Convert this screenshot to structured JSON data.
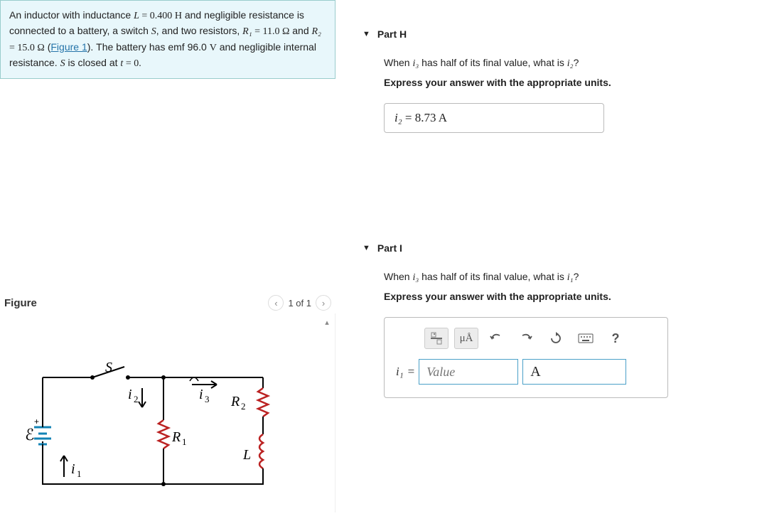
{
  "problem": {
    "text_pre_L": "An inductor with inductance ",
    "L_sym": "L",
    "L_eq": " = 0.400 ",
    "L_unit": "H",
    "text_after_L": " and negligible resistance is connected to a battery, a switch ",
    "S_sym": "S",
    "text_after_S": ", and two resistors, ",
    "R1_sym": "R₁",
    "R1_eq": " = 11.0 ",
    "ohm": "Ω",
    "and": " and ",
    "R2_sym": "R₂",
    "R2_eq": " = 15.0 ",
    "fig_open": " (",
    "figure_link": "Figure 1",
    "fig_close": "). The battery has emf 96.0 ",
    "V": "V",
    "text_after_emf": " and negligible internal resistance. ",
    "S_sym2": "S",
    "text_close": " is closed at ",
    "t_sym": "t",
    "t_eq": " = 0."
  },
  "figure": {
    "title": "Figure",
    "pager": "1 of 1",
    "labels": {
      "S": "S",
      "i1": "i₁",
      "i2": "i₂",
      "i3": "i₃",
      "R1": "R₁",
      "R2": "R₂",
      "L": "L",
      "emf": "ℰ"
    }
  },
  "partH": {
    "title": "Part H",
    "question_pre": "When ",
    "i3": "i₃",
    "question_mid": " has half of its final value, what is ",
    "i2": "i₂",
    "question_post": "?",
    "instruction": "Express your answer with the appropriate units.",
    "answer_lhs": "i₂",
    "answer_eq": " = ",
    "answer_val": "8.73 ",
    "answer_unit": "A"
  },
  "partI": {
    "title": "Part I",
    "question_pre": "When ",
    "i3": "i₃",
    "question_mid": " has half of its final value, what is ",
    "i1": "i₁",
    "question_post": "?",
    "instruction": "Express your answer with the appropriate units.",
    "lhs": "i₁",
    "eq": " = ",
    "value_placeholder": "Value",
    "unit_value": "A",
    "toolbar": {
      "frac": "frac-icon",
      "muA": "μÅ",
      "undo": "undo-icon",
      "redo": "redo-icon",
      "reset": "reset-icon",
      "keyboard": "keyboard-icon",
      "help": "?"
    }
  }
}
